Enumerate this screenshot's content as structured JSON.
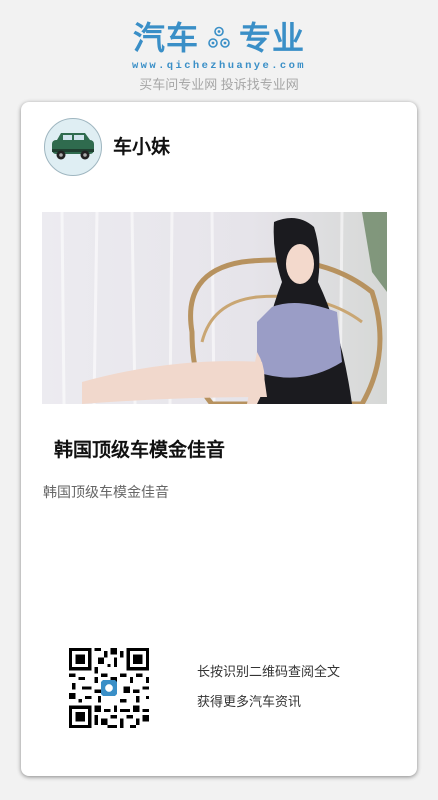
{
  "brand": {
    "logo_left": "汽车",
    "logo_right": "专业",
    "url": "www.qichezhuanye.com",
    "slogan": "买车问专业网 投诉找专业网",
    "accent_color": "#3a8fc7"
  },
  "card": {
    "author_name": "车小妹",
    "avatar_icon": "car-avatar-icon",
    "photo_alt": "韩国顶级车模金佳音",
    "title": "韩国顶级车模金佳音",
    "subtitle": "韩国顶级车模金佳音",
    "qr_line1": "长按识别二维码查阅全文",
    "qr_line2": "获得更多汽车资讯"
  }
}
